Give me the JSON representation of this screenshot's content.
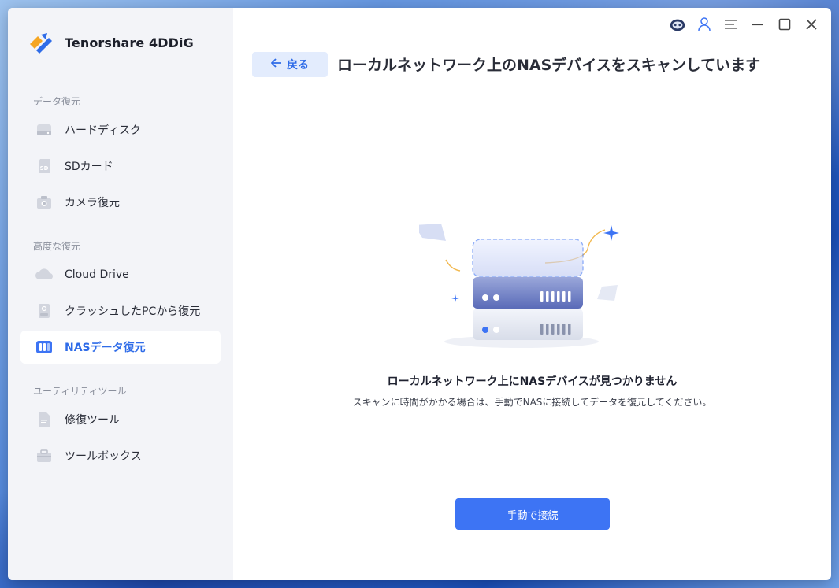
{
  "app": {
    "name": "Tenorshare 4DDiG"
  },
  "sidebar": {
    "sections": [
      {
        "label": "データ復元"
      },
      {
        "label": "高度な復元"
      },
      {
        "label": "ユーティリティツール"
      }
    ],
    "items": [
      {
        "label": "ハードディスク",
        "icon": "hard-disk-icon"
      },
      {
        "label": "SDカード",
        "icon": "sd-card-icon"
      },
      {
        "label": "カメラ復元",
        "icon": "camera-icon"
      },
      {
        "label": "Cloud Drive",
        "icon": "cloud-icon"
      },
      {
        "label": "クラッシュしたPCから復元",
        "icon": "crashed-pc-icon"
      },
      {
        "label": "NASデータ復元",
        "icon": "nas-icon",
        "active": true
      },
      {
        "label": "修復ツール",
        "icon": "repair-tool-icon"
      },
      {
        "label": "ツールボックス",
        "icon": "toolbox-icon"
      }
    ]
  },
  "header": {
    "back_label": "戻る",
    "title": "ローカルネットワーク上のNASデバイスをスキャンしています"
  },
  "empty_state": {
    "title": "ローカルネットワーク上にNASデバイスが見つかりません",
    "description": "スキャンに時間がかかる場合は、手動でNASに接続してデータを復元してください。"
  },
  "actions": {
    "connect_label": "手動で接続"
  },
  "colors": {
    "accent": "#3d74f4",
    "active_text": "#2f6ce8",
    "sidebar_bg": "#f3f4f8"
  }
}
